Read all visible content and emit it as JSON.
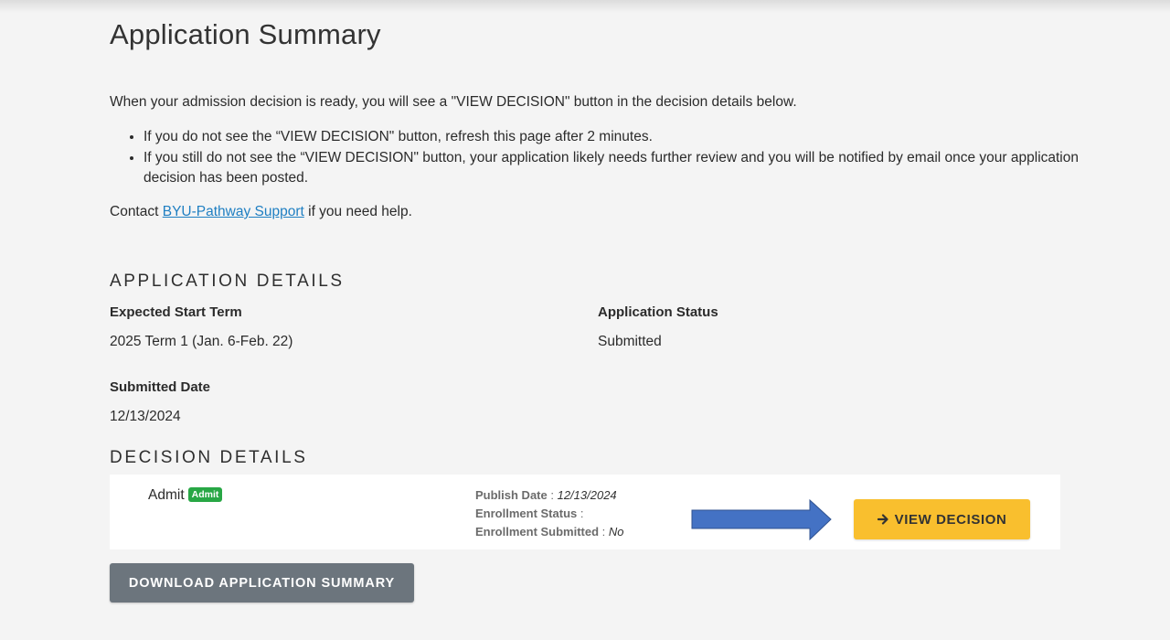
{
  "page": {
    "title": "Application Summary"
  },
  "intro": {
    "text": "When your admission decision is ready, you will see a \"VIEW DECISION\" button in the decision details below.",
    "bullets": [
      "If you do not see the “VIEW DECISION\" button, refresh this page after 2 minutes.",
      "If you still do not see the “VIEW DECISION\" button, your application likely needs further review and you will be notified by email once your application decision has been posted."
    ],
    "contact_prefix": "Contact",
    "contact_link": "BYU-Pathway Support",
    "contact_suffix": "if you need help."
  },
  "application_details": {
    "heading": "APPLICATION DETAILS",
    "start_term_label": "Expected Start Term",
    "start_term_value": "2025 Term 1 (Jan. 6-Feb. 22)",
    "status_label": "Application Status",
    "status_value": "Submitted",
    "submitted_date_label": "Submitted Date",
    "submitted_date_value": "12/13/2024"
  },
  "decision_details": {
    "heading": "DECISION DETAILS",
    "decision": "Admit",
    "badge": "Admit",
    "badge_color": "#28a745",
    "publish_date_label": "Publish Date",
    "publish_date_value": "12/13/2024",
    "enrollment_status_label": "Enrollment Status",
    "enrollment_status_value": "",
    "enrollment_submitted_label": "Enrollment Submitted",
    "enrollment_submitted_value": "No",
    "arrow_color": "#4472c4",
    "view_button_icon": "arrow-right-icon",
    "view_button_label": "VIEW DECISION",
    "view_button_color": "#f9bf2e"
  },
  "actions": {
    "download_label": "DOWNLOAD APPLICATION SUMMARY",
    "download_color": "#6c757d"
  }
}
